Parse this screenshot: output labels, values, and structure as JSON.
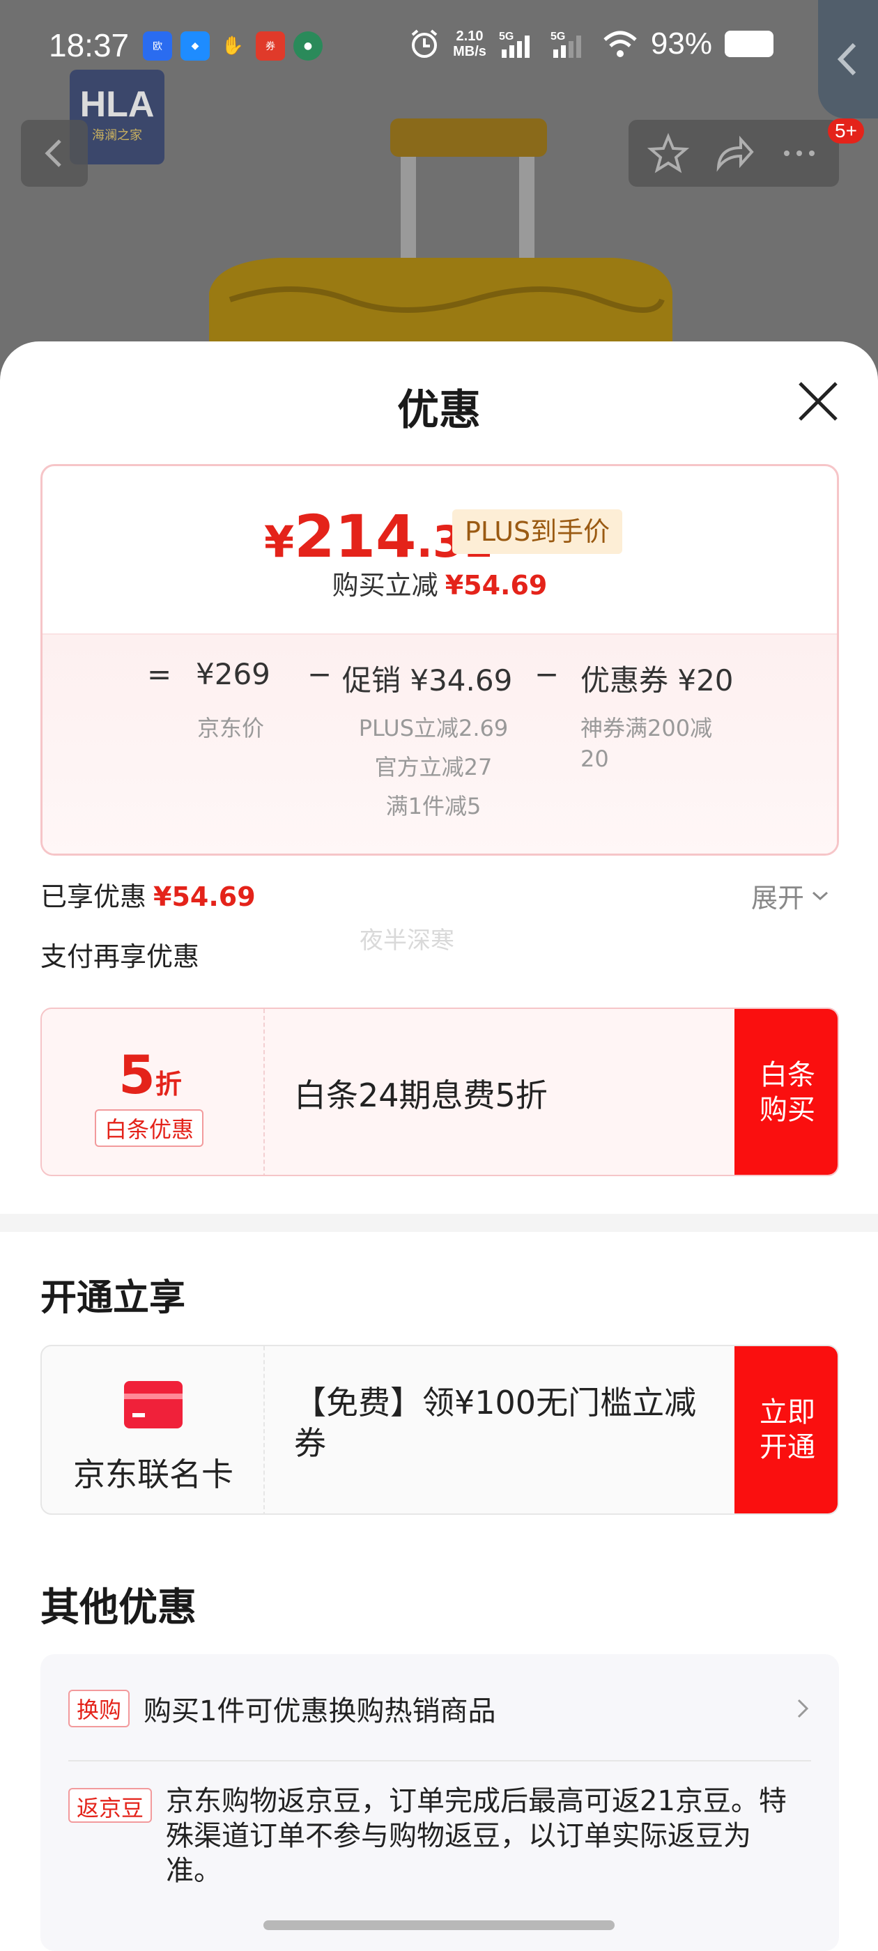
{
  "status_bar": {
    "time": "18:37",
    "net_speed_value": "2.10",
    "net_speed_unit": "MB/s",
    "signal1": "5G",
    "signal2": "5G",
    "battery": "93%",
    "app_icons": [
      "欧态",
      "logo-blue",
      "handshake",
      "app-red",
      "avatar"
    ]
  },
  "background": {
    "brand_logo": "HLA",
    "brand_sub": "海澜之家",
    "cart_badge": "5+"
  },
  "sheet": {
    "title": "优惠"
  },
  "price_card": {
    "final_price_yen": "¥",
    "final_price_int": "214",
    "final_price_dec": ".31",
    "plus_tag": "PLUS到手价",
    "reduce_label": "购买立减",
    "reduce_value": "¥54.69",
    "breakdown": {
      "eq": "=",
      "jd_price": "¥269",
      "jd_price_label": "京东价",
      "minus1": "−",
      "promo": "促销 ¥34.69",
      "promo_items": [
        "PLUS立减2.69",
        "官方立减27",
        "满1件减5"
      ],
      "minus2": "−",
      "coupon": "优惠券 ¥20",
      "coupon_desc_line1": "神券满200减",
      "coupon_desc_line2": "20"
    }
  },
  "enjoyed": {
    "label": "已享优惠",
    "value": "¥54.69",
    "expand": "展开",
    "watermark": "夜半深寒"
  },
  "pay_more": {
    "title": "支付再享优惠",
    "discount_num": "5",
    "discount_unit": "折",
    "tag": "白条优惠",
    "desc": "白条24期息费5折",
    "button_line1": "白条",
    "button_line2": "购买"
  },
  "open_section": {
    "title": "开通立享",
    "card_name": "京东联名卡",
    "desc": "【免费】领¥100无门槛立减券",
    "button_line1": "立即",
    "button_line2": "开通"
  },
  "other": {
    "title": "其他优惠",
    "item1_tag": "换购",
    "item1_text": "购买1件可优惠换购热销商品",
    "item2_tag": "返京豆",
    "item2_text": "京东购物返京豆，订单完成后最高可返21京豆。特殊渠道订单不参与购物返豆，以订单实际返豆为准。"
  },
  "colors": {
    "accent_red": "#e4231a",
    "button_red": "#fa0f0f",
    "plus_bg": "#fdeed6"
  }
}
